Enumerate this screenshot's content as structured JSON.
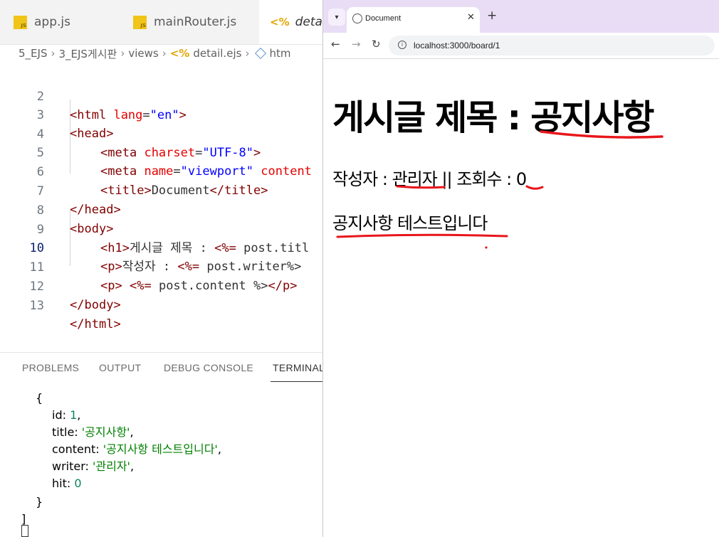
{
  "editor": {
    "tabs": [
      {
        "label": "app.js",
        "icon": "js-file-icon"
      },
      {
        "label": "mainRouter.js",
        "icon": "js-file-icon"
      },
      {
        "label": "detail",
        "icon": "ejs-file-icon"
      }
    ],
    "breadcrumb": [
      "5_EJS",
      "3_EJS게시판",
      "views",
      "detail.ejs",
      "htm"
    ],
    "lines": [
      {
        "n": "2"
      },
      {
        "n": "3"
      },
      {
        "n": "4"
      },
      {
        "n": "5"
      },
      {
        "n": "6"
      },
      {
        "n": "7"
      },
      {
        "n": "8"
      },
      {
        "n": "9"
      },
      {
        "n": "10"
      },
      {
        "n": "11"
      },
      {
        "n": "12"
      },
      {
        "n": "13"
      }
    ],
    "code": {
      "l2_tag": "html",
      "l2_attr": "lang",
      "l2_val": "\"en\"",
      "l3_tag": "head",
      "l4_tag": "meta",
      "l4_attr": "charset",
      "l4_val": "\"UTF-8\"",
      "l5_tag": "meta",
      "l5_attr": "name",
      "l5_val": "\"viewport\"",
      "l5_attr2": "content",
      "l6_tag": "title",
      "l6_text": "Document",
      "l7_tag": "head",
      "l8_tag": "body",
      "l9_tag": "h1",
      "l9_text": "게시글 제목 : ",
      "l9_ejs": "<%=",
      "l9_rest": " post.titl",
      "l10_tag": "p",
      "l10_text": "작성자 : ",
      "l10_ejs": "<%=",
      "l10_rest": " post.writer%>",
      "l11_tag": "p",
      "l11_ejs": "<%=",
      "l11_rest": " post.content %>",
      "l12_tag": "body",
      "l13_tag": "html"
    },
    "panel_tabs": [
      "PROBLEMS",
      "OUTPUT",
      "DEBUG CONSOLE",
      "TERMINAL"
    ],
    "terminal": {
      "open": "{",
      "id_key": "id: ",
      "id_val": "1",
      "title_key": "title: ",
      "title_val": "'공지사항'",
      "content_key": "content: ",
      "content_val": "'공지사항 테스트입니다'",
      "writer_key": "writer: ",
      "writer_val": "'관리자'",
      "hit_key": "hit: ",
      "hit_val": "0",
      "close": "}",
      "bracket": "]"
    }
  },
  "browser": {
    "tab_title": "Document",
    "url": "localhost:3000/board/1",
    "page": {
      "h1_label": "게시글 제목 : ",
      "h1_value": "공지사항",
      "writer_label": "작성자 : ",
      "writer_value": "관리자",
      "hits_sep": " || 조회수 : ",
      "hits_value": "0",
      "content": "공지사항 테스트입니다"
    },
    "annotation_color": "#e8161b"
  }
}
